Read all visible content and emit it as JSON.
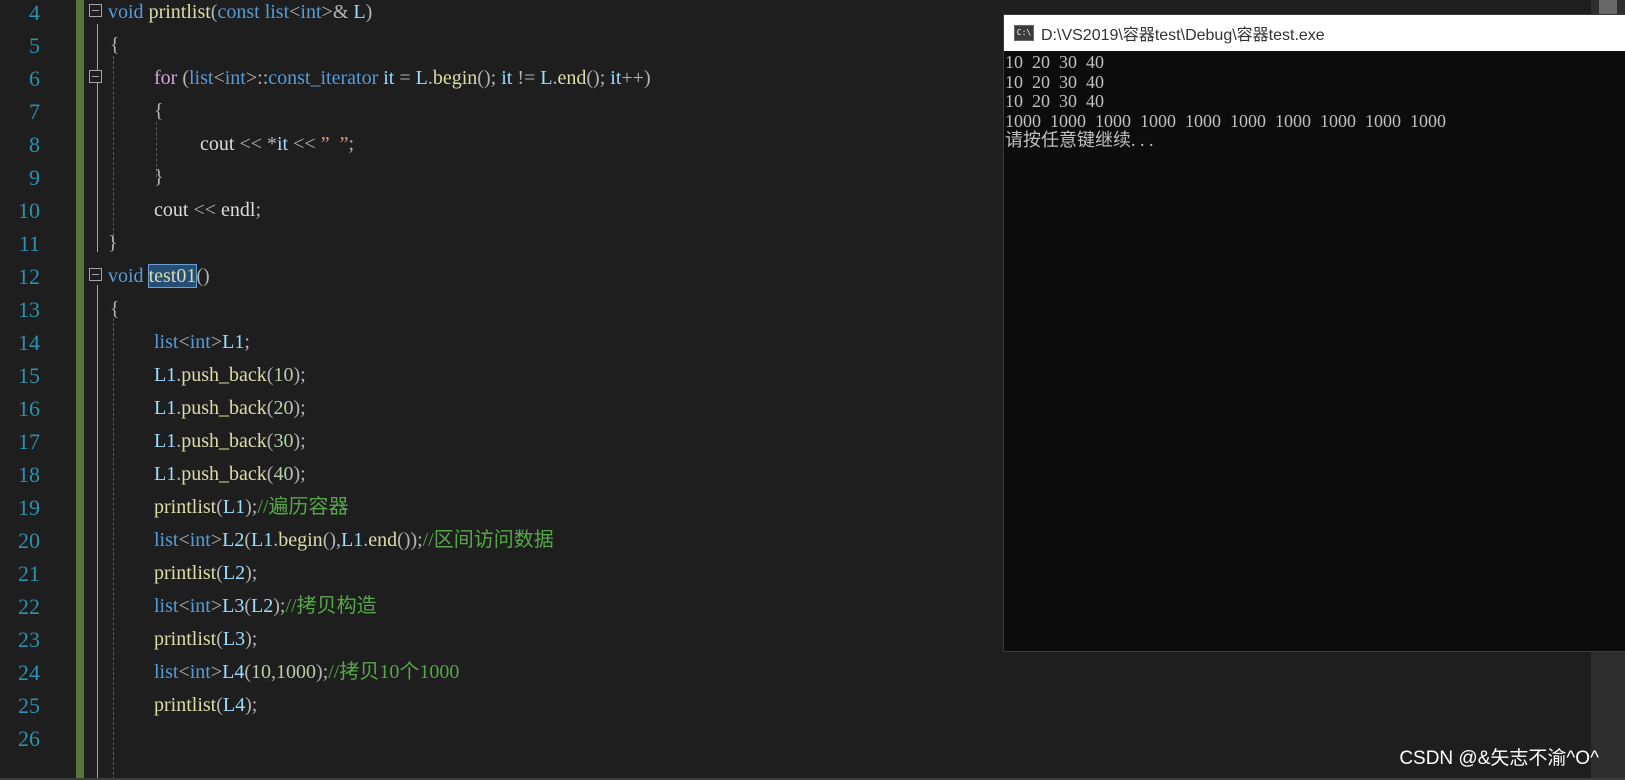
{
  "console": {
    "title": "D:\\VS2019\\容器test\\Debug\\容器test.exe",
    "icon": "C:\\",
    "lines": [
      "10  20  30  40",
      "10  20  30  40",
      "10  20  30  40",
      "1000  1000  1000  1000  1000  1000  1000  1000  1000  1000",
      "请按任意键继续. . ."
    ]
  },
  "watermark": "CSDN @&矢志不渝^O^",
  "line_numbers": [
    "4",
    "5",
    "6",
    "7",
    "8",
    "9",
    "10",
    "11",
    "12",
    "13",
    "14",
    "15",
    "16",
    "17",
    "18",
    "19",
    "20",
    "21",
    "22",
    "23",
    "24",
    "25",
    "26"
  ],
  "code": {
    "l4": [
      "void",
      " ",
      "printlist",
      "(",
      "const",
      " ",
      "list",
      "<",
      "int",
      ">&",
      " ",
      "L",
      ")"
    ],
    "l5": [
      "{"
    ],
    "l6": [
      "for",
      " (",
      "list",
      "<",
      "int",
      ">::",
      "const_iterator",
      " ",
      "it",
      " = ",
      "L",
      ".",
      "begin",
      "(); ",
      "it",
      " != ",
      "L",
      ".",
      "end",
      "(); ",
      "it",
      "++)"
    ],
    "l7": [
      "{"
    ],
    "l8": [
      "cout",
      " << *",
      "it",
      " << ",
      "”  ”",
      ";"
    ],
    "l9": [
      "}"
    ],
    "l10": [
      "cout",
      " << ",
      "endl",
      ";"
    ],
    "l11": [
      "}"
    ],
    "l12": [
      "void",
      " ",
      "test01",
      "()"
    ],
    "l13": [
      "{"
    ],
    "l14": [
      "list",
      "<",
      "int",
      ">",
      "L1",
      ";"
    ],
    "l15": [
      "L1",
      ".",
      "push_back",
      "(",
      "10",
      ");"
    ],
    "l16": [
      "L1",
      ".",
      "push_back",
      "(",
      "20",
      ");"
    ],
    "l17": [
      "L1",
      ".",
      "push_back",
      "(",
      "30",
      ");"
    ],
    "l18": [
      "L1",
      ".",
      "push_back",
      "(",
      "40",
      ");"
    ],
    "l19": [
      "printlist",
      "(",
      "L1",
      ");",
      "//遍历容器"
    ],
    "l20": [
      "list",
      "<",
      "int",
      ">",
      "L2",
      "(",
      "L1",
      ".",
      "begin",
      "(),",
      "L1",
      ".",
      "end",
      "());",
      "//区间访问数据"
    ],
    "l21": [
      "printlist",
      "(",
      "L2",
      ");"
    ],
    "l22": [
      "list",
      "<",
      "int",
      ">",
      "L3",
      "(",
      "L2",
      ");",
      "//拷贝构造"
    ],
    "l23": [
      "printlist",
      "(",
      "L3",
      ");"
    ],
    "l24": [
      "list",
      "<",
      "int",
      ">",
      "L4",
      "(",
      "10",
      ",",
      "1000",
      ");",
      "//拷贝10个1000"
    ],
    "l25": [
      "printlist",
      "(",
      "L4",
      ");"
    ],
    "l26": []
  },
  "colors": {
    "keyword": "#569cd6",
    "function": "#dcdcaa",
    "variable": "#9cdcfe",
    "string": "#d69d85",
    "comment": "#57a64a",
    "number": "#b5cea8",
    "line_number": "#2b91af",
    "change_bar": "#57743b",
    "selection": "#264f78"
  }
}
